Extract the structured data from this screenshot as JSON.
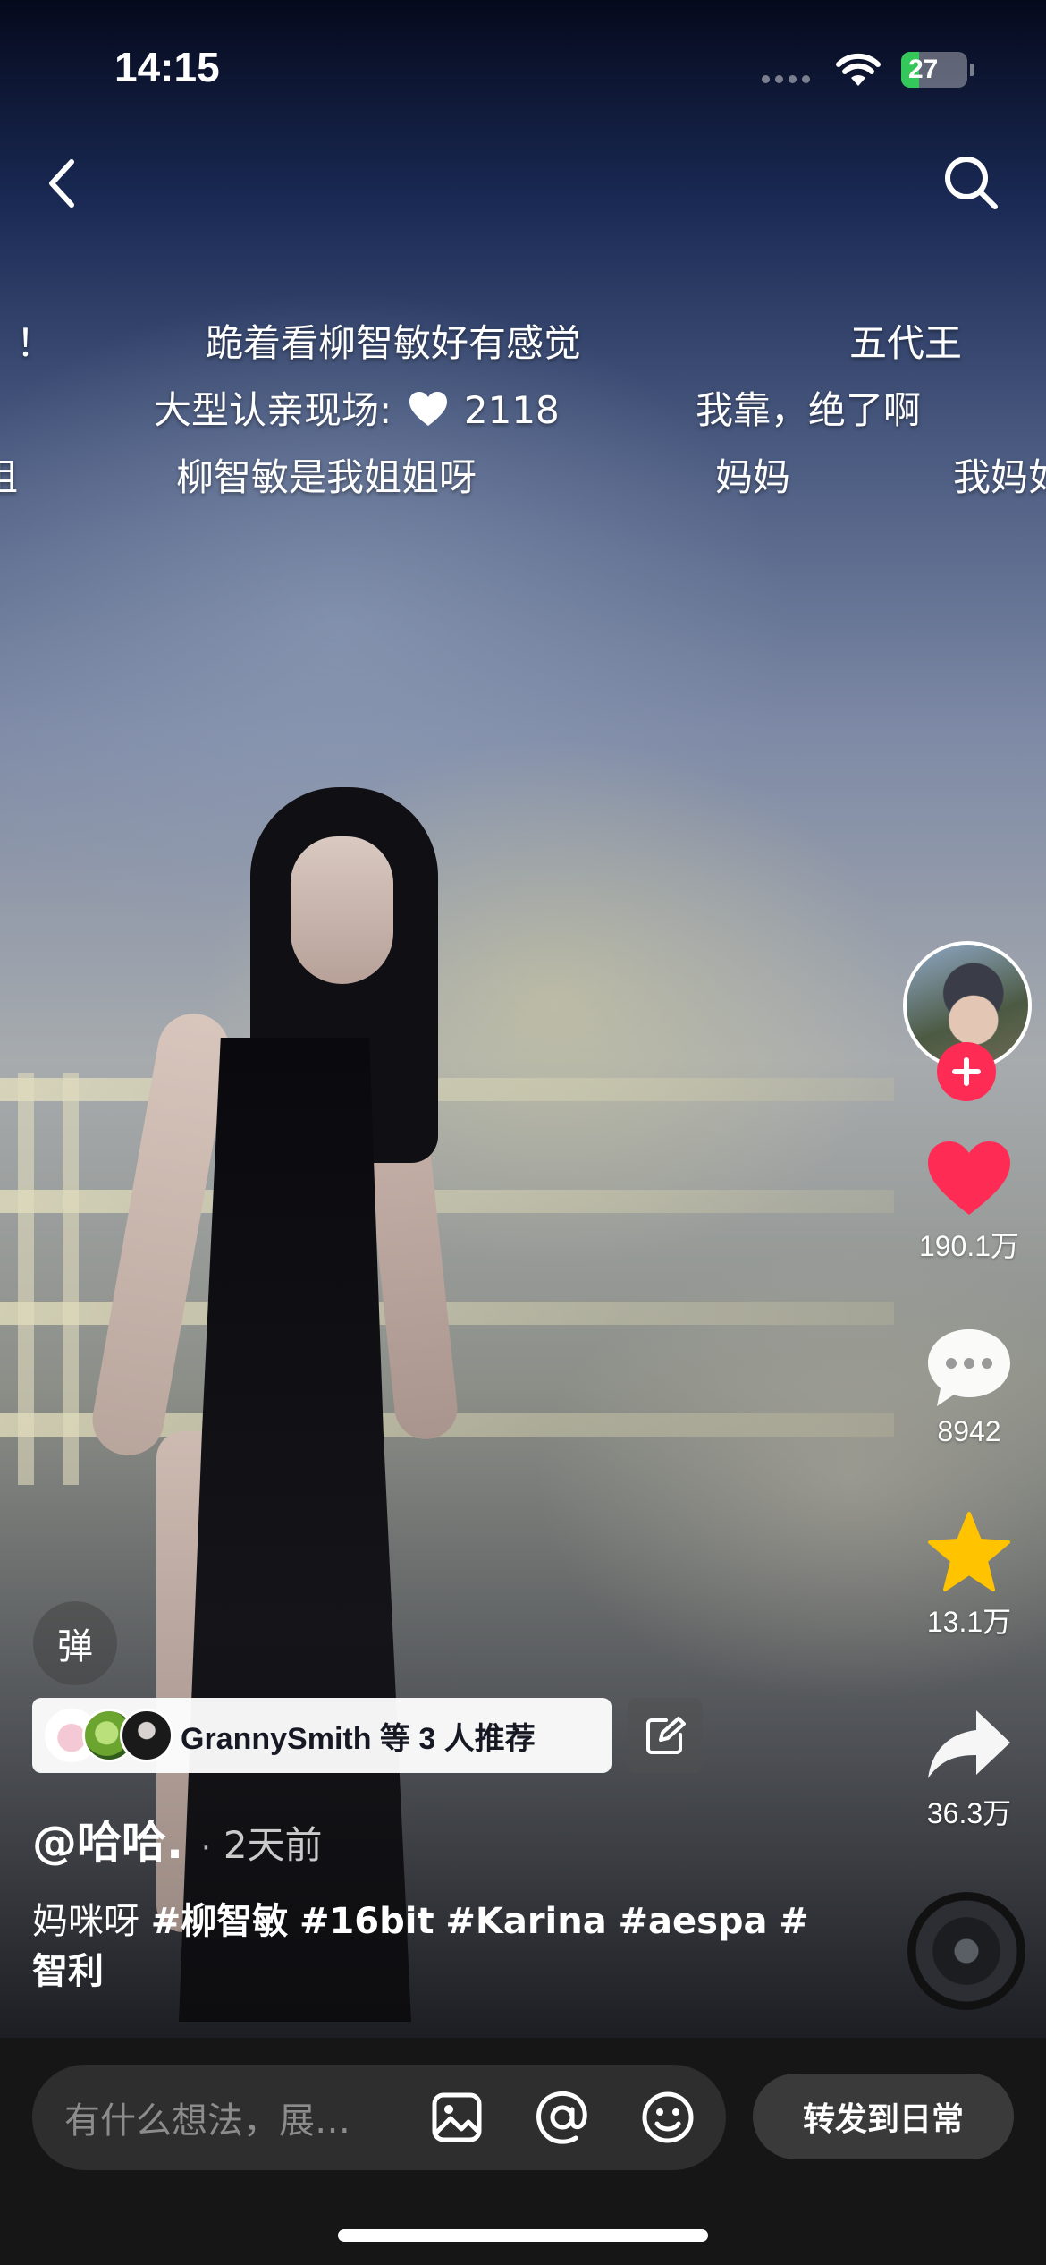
{
  "status_bar": {
    "time": "14:15",
    "battery": "27",
    "battery_level_percent": 27
  },
  "danmaku": [
    {
      "text": "！"
    },
    {
      "text": "跪着看柳智敏好有感觉"
    },
    {
      "text": "五代王"
    },
    {
      "text": "大型认亲现场:",
      "likes": "2118"
    },
    {
      "text": "我靠，绝了啊"
    },
    {
      "text": "姐"
    },
    {
      "text": "柳智敏是我姐姐呀"
    },
    {
      "text": "妈妈"
    },
    {
      "text": "我妈如"
    }
  ],
  "side_actions": {
    "likes": "190.1万",
    "comments": "8942",
    "favorites": "13.1万",
    "shares": "36.3万"
  },
  "danmu_toggle": "弹",
  "recommend": {
    "text": "GrannySmith 等 3 人推荐"
  },
  "author": {
    "name": "@哈哈.",
    "dot": "·",
    "time": "2天前"
  },
  "caption": {
    "prefix": "妈咪呀 ",
    "hashtags": [
      "#柳智敏",
      "#16bit",
      "#Karina",
      "#aespa",
      "#智利"
    ]
  },
  "bottom": {
    "placeholder": "有什么想法，展…",
    "forward_label": "转发到日常"
  },
  "colors": {
    "accent": "#fe2c55",
    "favorite": "#ffc300",
    "battery": "#34c759"
  },
  "icons": [
    "back-icon",
    "search-icon",
    "heart-icon",
    "comment-icon",
    "star-icon",
    "share-icon",
    "plus-icon",
    "edit-icon",
    "image-icon",
    "at-icon",
    "emoji-icon",
    "wifi-icon"
  ]
}
